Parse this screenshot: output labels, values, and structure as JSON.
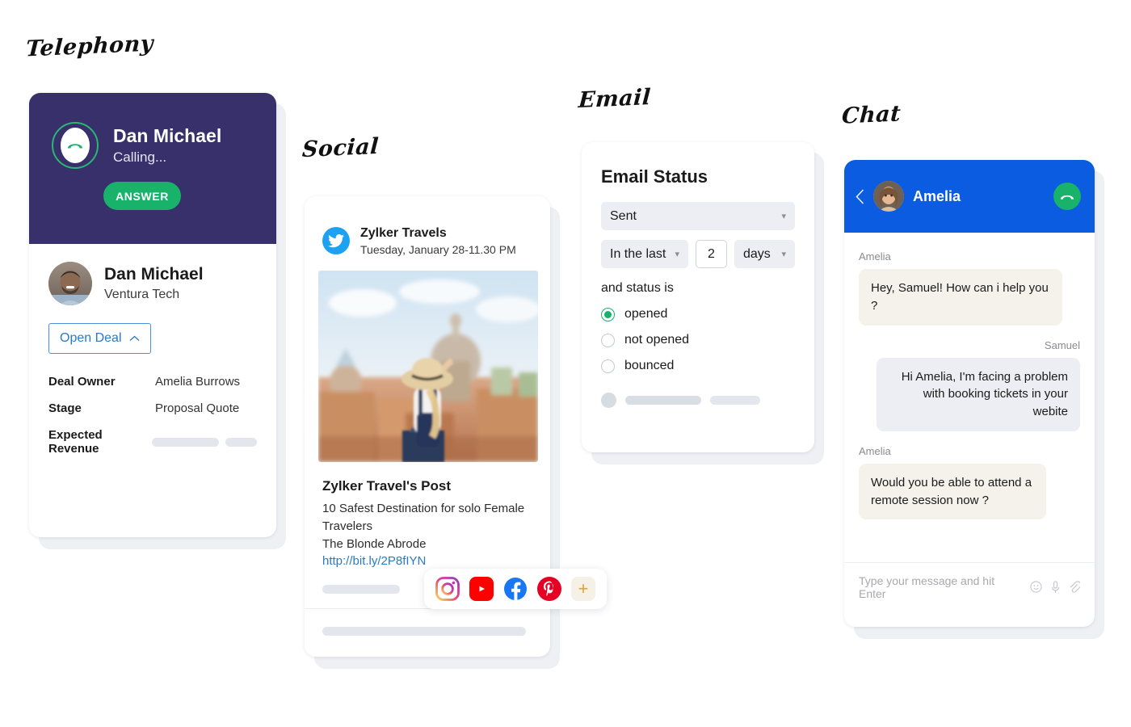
{
  "labels": {
    "telephony": "Telephony",
    "social": "Social",
    "email": "Email",
    "chat": "Chat"
  },
  "colors": {
    "telephony_header": "#37306B",
    "answer_green": "#18b26b",
    "chat_header_blue": "#0B5CE0",
    "link_blue": "#2a7ac4",
    "radio_green": "#17b26a",
    "twitter_blue": "#1DA1F2"
  },
  "telephony": {
    "caller_name": "Dan Michael",
    "call_status": "Calling...",
    "answer_label": "ANSWER",
    "contact_name": "Dan Michael",
    "contact_org": "Ventura Tech",
    "open_deal_label": "Open Deal",
    "open_deal_chevron": "chevron-up-icon",
    "fields": [
      {
        "label": "Deal Owner",
        "value": "Amelia Burrows",
        "skeleton": false
      },
      {
        "label": "Stage",
        "value": "Proposal Quote",
        "skeleton": false
      },
      {
        "label": "Expected Revenue",
        "value": "",
        "skeleton": true
      }
    ]
  },
  "social": {
    "network": "twitter-icon",
    "author": "Zylker Travels",
    "timestamp": "Tuesday, January 28-11.30 PM",
    "post_title": "Zylker Travel's Post",
    "post_text_line1": "10 Safest Destination for solo Female Travelers",
    "post_text_line2_prefix": "The Blonde Abrode ",
    "post_link": "http://bit.ly/2P8fIYN",
    "icons": [
      {
        "name": "instagram-icon",
        "label": "Instagram"
      },
      {
        "name": "youtube-icon",
        "label": "YouTube"
      },
      {
        "name": "facebook-icon",
        "label": "Facebook"
      },
      {
        "name": "pinterest-icon",
        "label": "Pinterest"
      },
      {
        "name": "add-channel-icon",
        "label": "+"
      }
    ]
  },
  "email": {
    "title": "Email Status",
    "status_select": "Sent",
    "range_select": "In the last",
    "amount": "2",
    "unit_select": "days",
    "sub_label": "and status is",
    "options": [
      {
        "label": "opened",
        "selected": true
      },
      {
        "label": "not opened",
        "selected": false
      },
      {
        "label": "bounced",
        "selected": false
      }
    ]
  },
  "chat": {
    "contact": "Amelia",
    "back_icon": "chevron-left-icon",
    "hangup_icon": "end-call-icon",
    "messages": [
      {
        "sender": "Amelia",
        "side": "left",
        "text": "Hey, Samuel! How can i help you ?"
      },
      {
        "sender": "Samuel",
        "side": "right",
        "text": "Hi Amelia, I'm facing a problem with booking tickets in your webite"
      },
      {
        "sender": "Amelia",
        "side": "left",
        "text": "Would you be able to attend a remote session now ?"
      }
    ],
    "input_placeholder": "Type your message and hit Enter",
    "input_icons": [
      "emoji-icon",
      "microphone-icon",
      "attachment-icon"
    ]
  }
}
